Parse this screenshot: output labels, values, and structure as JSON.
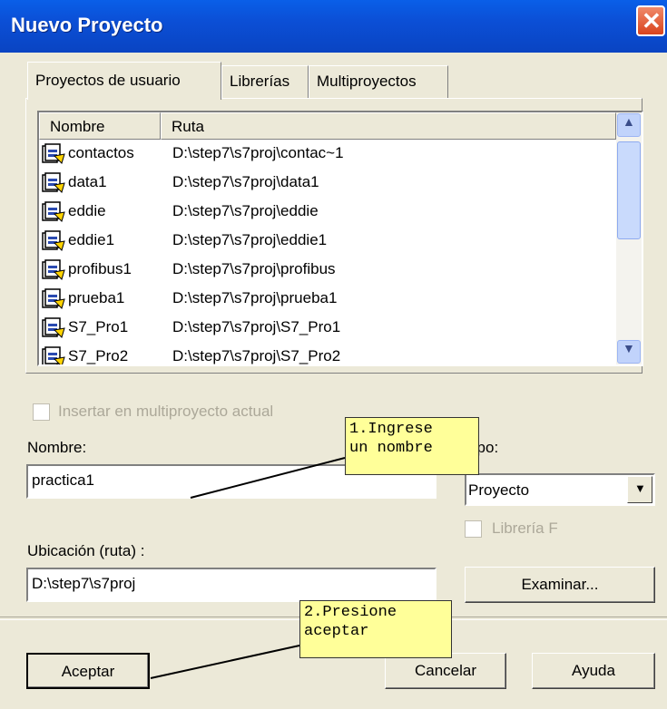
{
  "window": {
    "title": "Nuevo Proyecto"
  },
  "tabs": [
    {
      "label": "Proyectos de usuario"
    },
    {
      "label": "Librerías"
    },
    {
      "label": "Multiproyectos"
    }
  ],
  "list": {
    "headers": {
      "name": "Nombre",
      "path": "Ruta"
    },
    "rows": [
      {
        "name": "contactos",
        "path": "D:\\step7\\s7proj\\contac~1"
      },
      {
        "name": "data1",
        "path": "D:\\step7\\s7proj\\data1"
      },
      {
        "name": "eddie",
        "path": "D:\\step7\\s7proj\\eddie"
      },
      {
        "name": "eddie1",
        "path": "D:\\step7\\s7proj\\eddie1"
      },
      {
        "name": "profibus1",
        "path": "D:\\step7\\s7proj\\profibus"
      },
      {
        "name": "prueba1",
        "path": "D:\\step7\\s7proj\\prueba1"
      },
      {
        "name": "S7_Pro1",
        "path": "D:\\step7\\s7proj\\S7_Pro1"
      },
      {
        "name": "S7_Pro2",
        "path": "D:\\step7\\s7proj\\S7_Pro2"
      }
    ]
  },
  "form": {
    "insert_multiproject_label": "Insertar en multiproyecto actual",
    "name_label": "Nombre:",
    "name_value": "practica1",
    "type_label": "Tipo:",
    "type_value": "Proyecto",
    "library_label": "Librería F",
    "location_label": "Ubicación (ruta) :",
    "location_value": "D:\\step7\\s7proj",
    "browse_label": "Examinar..."
  },
  "buttons": {
    "accept": "Aceptar",
    "cancel": "Cancelar",
    "help": "Ayuda"
  },
  "annotations": {
    "note1": "1.Ingrese\nun nombre",
    "note2": "2.Presione\naceptar"
  }
}
